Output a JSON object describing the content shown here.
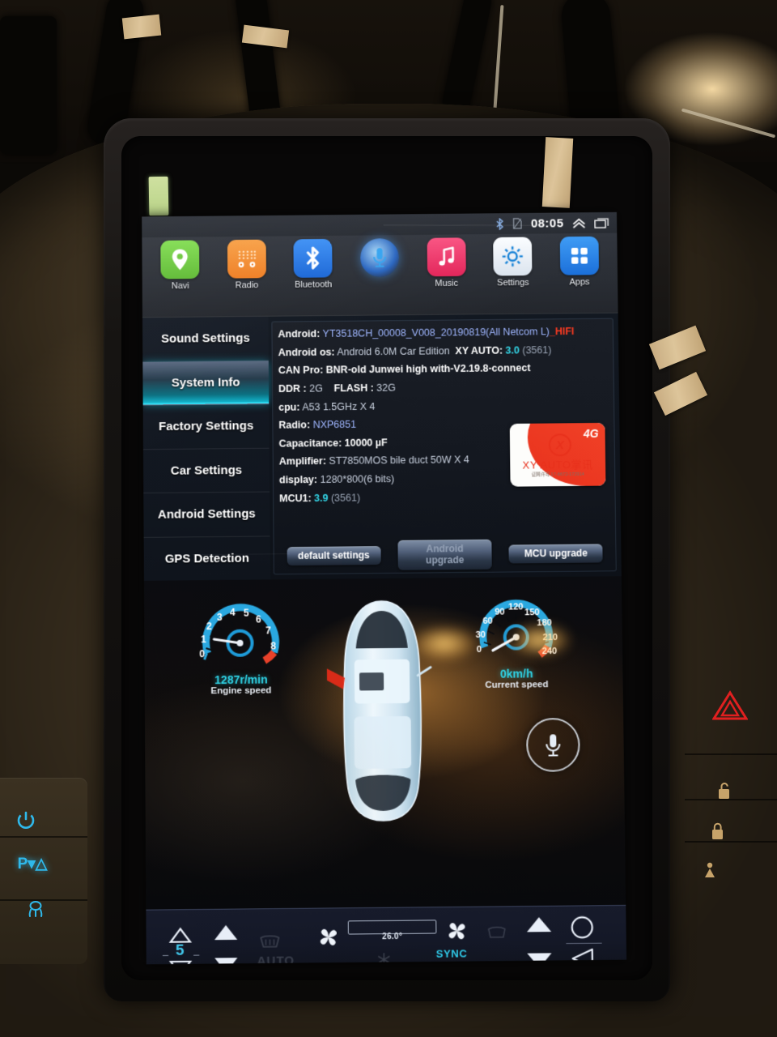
{
  "device": {
    "kind": "android-car-head-unit",
    "screen_label": "Tesla-style vertical car radio"
  },
  "statusbar": {
    "bluetooth_icon": "bluetooth-icon",
    "sim_icon": "sim-card-icon",
    "time": "08:05",
    "expand_icon": "chevron-double-up-icon",
    "recents_icon": "recent-apps-icon"
  },
  "dock": {
    "apps": [
      {
        "label": "Navi",
        "icon": "location-pin-icon",
        "color": "#6ec83f"
      },
      {
        "label": "Radio",
        "icon": "radio-icon",
        "color": "#f08a30"
      },
      {
        "label": "Bluetooth",
        "icon": "bluetooth-icon",
        "color": "#2278e8"
      },
      {
        "label": "",
        "icon": "microphone-icon",
        "color": "#1f6fd6"
      },
      {
        "label": "Music",
        "icon": "music-note-icon",
        "color": "#ef3a6a"
      },
      {
        "label": "Settings",
        "icon": "gear-icon",
        "color": "#e8eef5"
      },
      {
        "label": "Apps",
        "icon": "grid-apps-icon",
        "color": "#2b87e8"
      }
    ]
  },
  "sidebar": {
    "items": [
      {
        "label": "Sound Settings",
        "active": false
      },
      {
        "label": "System Info",
        "active": true
      },
      {
        "label": "Factory Settings",
        "active": false
      },
      {
        "label": "Car Settings",
        "active": false
      },
      {
        "label": "Android Settings",
        "active": false
      },
      {
        "label": "GPS Detection",
        "active": false
      }
    ]
  },
  "system_info": {
    "android_key": "Android:",
    "android_value": "YT3518CH_00008_V008_20190819(All Netcom L)",
    "android_suffix": "_HIFI",
    "os_key": "Android os:",
    "os_value": "Android 6.0M Car Edition",
    "xyauto_key": "XY AUTO:",
    "xyauto_value": "3.0",
    "xyauto_build": "(3561)",
    "canpro_key": "CAN Pro:",
    "canpro_value": "BNR-old Junwei high with-V2.19.8-connect",
    "ddr_key": "DDR :",
    "ddr_value": "2G",
    "flash_key": "FLASH :",
    "flash_value": "32G",
    "cpu_key": "cpu:",
    "cpu_value": "A53 1.5GHz X 4",
    "radio_key": "Radio:",
    "radio_value": "NXP6851",
    "cap_key": "Capacitance:",
    "cap_value": "10000 µF",
    "amp_key": "Amplifier:",
    "amp_value": "ST7850MOS bile duct 50W X 4",
    "display_key": "display:",
    "display_value": "1280*800(6 bits)",
    "mcu_key": "MCU1:",
    "mcu_value": "3.9",
    "mcu_build": "(3561)"
  },
  "vendor_badge": {
    "mark": "X",
    "name": "XY AUTO掌讯",
    "network": "4G",
    "license": "证网许可 17-8672-172914"
  },
  "action_buttons": [
    {
      "label": "default settings",
      "name": "default-settings-button"
    },
    {
      "label": "Android\nupgrade",
      "name": "android-upgrade-button"
    },
    {
      "label": "MCU upgrade",
      "name": "mcu-upgrade-button"
    }
  ],
  "gauges": {
    "tach": {
      "value": "1287r/min",
      "caption": "Engine speed",
      "ticks": [
        "0",
        "1",
        "2",
        "3",
        "4",
        "5",
        "6",
        "7",
        "8"
      ],
      "needle_value": 1.287,
      "redline_from": 6
    },
    "speedo": {
      "value": "0km/h",
      "caption": "Current speed",
      "ticks": [
        "0",
        "30",
        "60",
        "90",
        "120",
        "150",
        "180",
        "210",
        "240"
      ],
      "needle_value": 0,
      "redline_from": 180
    }
  },
  "car_view": {
    "door_open_indicator": "front-left-door-open",
    "mic_icon": "microphone-icon"
  },
  "climate": {
    "left_seat_up_icon": "triangle-up-outline-icon",
    "left_seat_down_icon": "triangle-down-outline-icon",
    "fan_level": "5",
    "fan_up_icon": "triangle-up-icon",
    "fan_down_icon": "triangle-down-icon",
    "rear_defrost_icon": "rear-defrost-icon",
    "auto_label": "AUTO",
    "fan_left_icon": "fan-icon",
    "temperature": "26.0°",
    "ac_icon": "snowflake-icon",
    "fan_right_icon": "fan-icon",
    "sync_label": "SYNC",
    "recirculate_icon": "air-recirculation-icon",
    "front_defrost_icon": "front-defrost-icon",
    "vol_up_icon": "triangle-up-icon",
    "vol_down_icon": "triangle-down-icon",
    "home_icon": "home-circle-icon",
    "back_icon": "back-triangle-icon"
  },
  "car_controls": {
    "left": [
      {
        "icon": "power-icon",
        "name": "power-button"
      },
      {
        "icon": "park-assist-icon",
        "name": "park-assist-button"
      },
      {
        "icon": "traction-control-icon",
        "name": "traction-control-button"
      }
    ],
    "right": [
      {
        "icon": "hazard-triangle-icon",
        "name": "hazard-button",
        "color": "#e02020"
      },
      {
        "icon": "unlock-icon",
        "name": "unlock-button",
        "color": "#c7a36a"
      },
      {
        "icon": "lock-icon",
        "name": "lock-button",
        "color": "#c7a36a"
      },
      {
        "icon": "child-seat-icon",
        "name": "passenger-airbag-button",
        "color": "#c7a36a"
      }
    ]
  },
  "colors": {
    "accent_cyan": "#2fd3e6",
    "warn_red": "#ff3b21",
    "sidebar_active": "#12c3dc",
    "screen_bg": "#0a0d14"
  }
}
